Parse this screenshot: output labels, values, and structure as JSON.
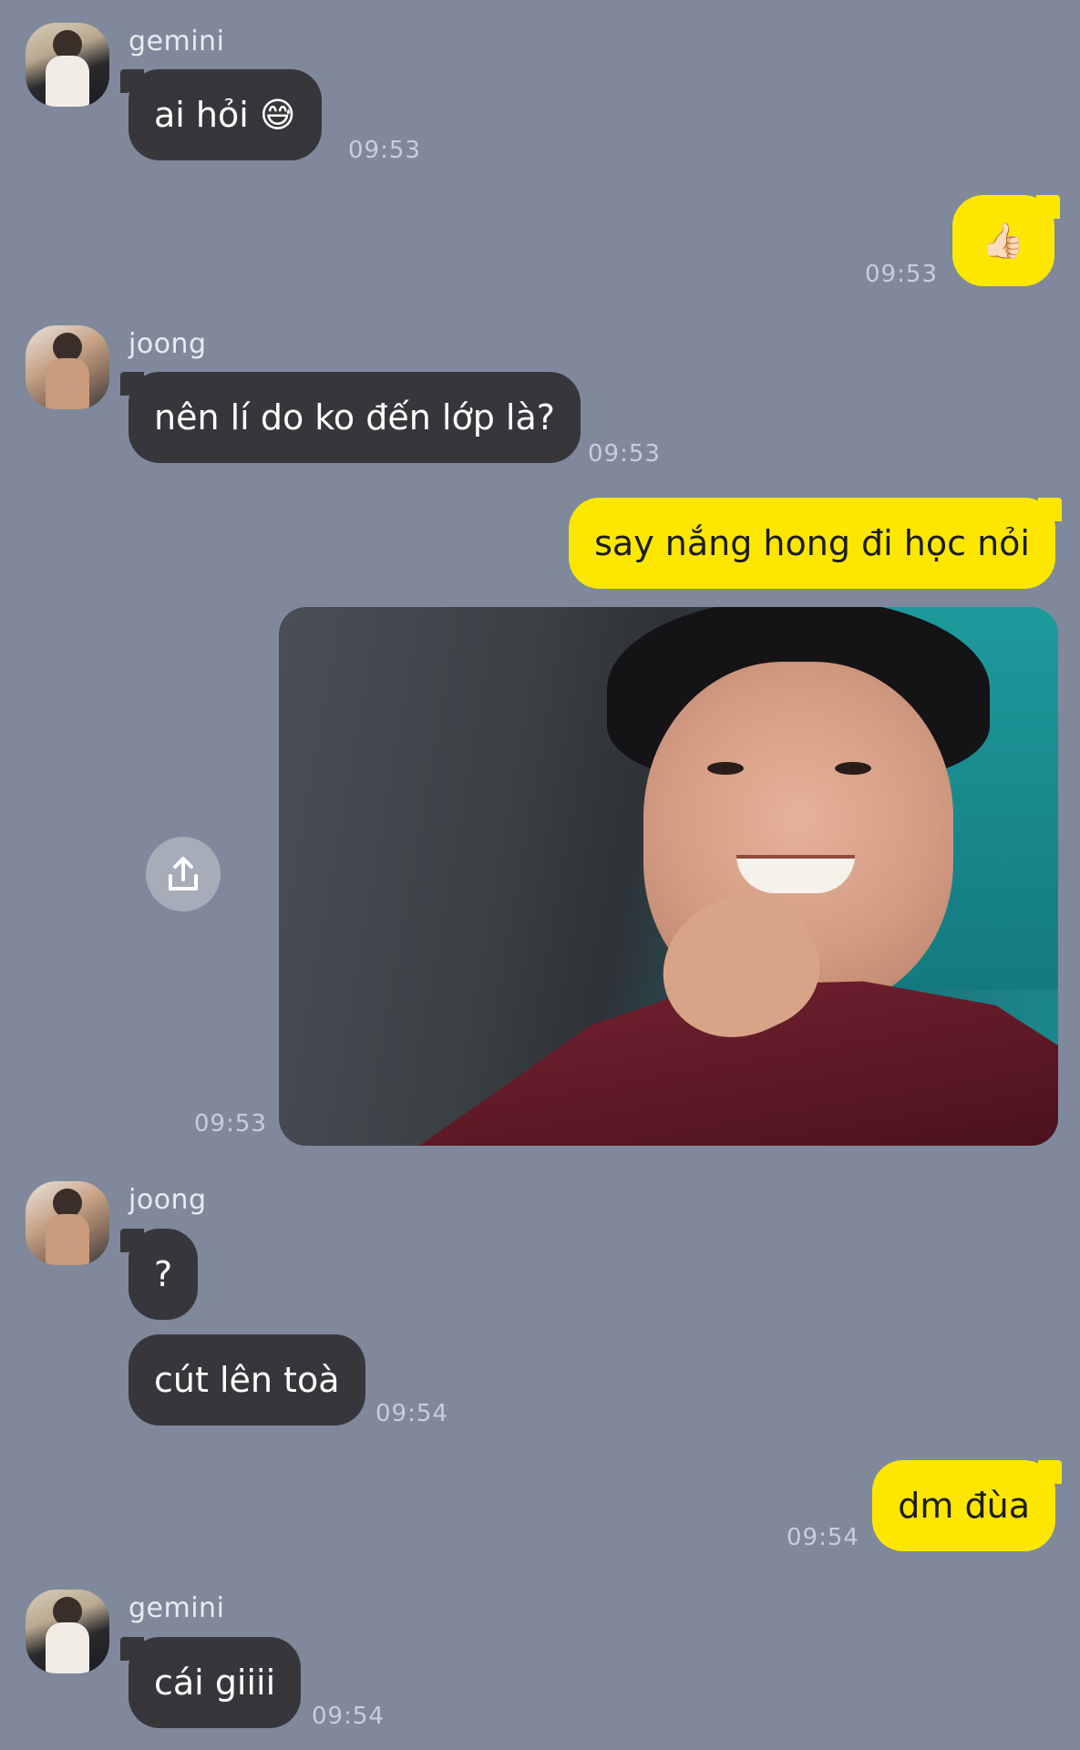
{
  "messages": [
    {
      "sender": "gemini",
      "text": "ai hỏi 😅",
      "time": "09:53"
    },
    {
      "text": "👍🏻",
      "time": "09:53"
    },
    {
      "sender": "joong",
      "text": "nên lí do ko đến lớp là?",
      "time": "09:53"
    },
    {
      "text": "say nắng hong đi học nỏi"
    },
    {
      "time": "09:53"
    },
    {
      "sender": "joong",
      "text": "?"
    },
    {
      "text": "cút lên toà",
      "time": "09:54"
    },
    {
      "text": "dm đùa",
      "time": "09:54"
    },
    {
      "sender": "gemini",
      "text": "cái giiii",
      "time": "09:54"
    }
  ],
  "icons": {
    "share": "share-upload-icon"
  },
  "colors": {
    "background": "#7f899b",
    "incoming_bubble": "#37373b",
    "outgoing_bubble": "#fde700"
  }
}
